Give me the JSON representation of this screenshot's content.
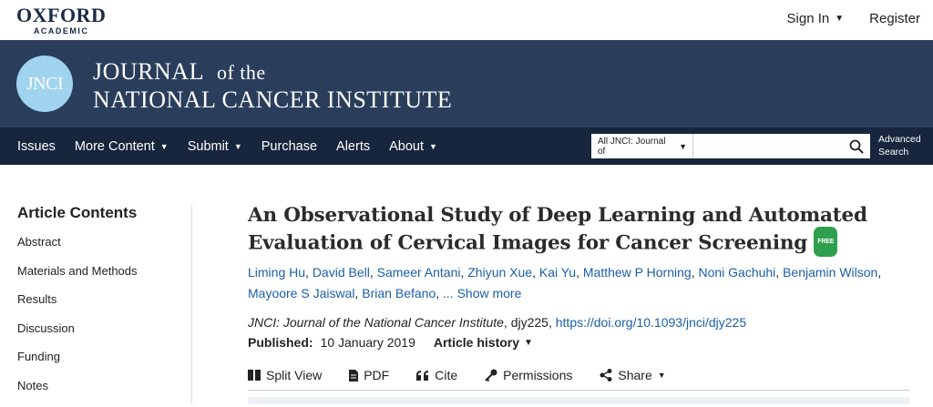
{
  "brand": {
    "word1": "OXFORD",
    "word2": "ACADEMIC"
  },
  "account": {
    "sign_in": "Sign In",
    "register": "Register"
  },
  "journal": {
    "logo": "JNCI",
    "line1a": "JOURNAL",
    "line1b": "of the",
    "line2": "NATIONAL CANCER INSTITUTE"
  },
  "nav": {
    "items": [
      {
        "label": "Issues",
        "dropdown": false
      },
      {
        "label": "More Content",
        "dropdown": true
      },
      {
        "label": "Submit",
        "dropdown": true
      },
      {
        "label": "Purchase",
        "dropdown": false
      },
      {
        "label": "Alerts",
        "dropdown": false
      },
      {
        "label": "About",
        "dropdown": true
      }
    ],
    "search_scope": "All JNCI: Journal of",
    "search_value": "",
    "advanced_line1": "Advanced",
    "advanced_line2": "Search"
  },
  "sidebar": {
    "heading": "Article Contents",
    "items": [
      "Abstract",
      "Materials and Methods",
      "Results",
      "Discussion",
      "Funding",
      "Notes"
    ]
  },
  "article": {
    "title": "An Observational Study of Deep Learning and Automated Evaluation of Cervical Images for Cancer Screening",
    "free_badge": "FREE",
    "authors": [
      "Liming Hu",
      "David Bell",
      "Sameer Antani",
      "Zhiyun Xue",
      "Kai Yu",
      "Matthew P Horning",
      "Noni Gachuhi",
      "Benjamin Wilson",
      "Mayoore S Jaiswal",
      "Brian Befano"
    ],
    "show_more": "... Show more",
    "journal_name": "JNCI: Journal of the National Cancer Institute",
    "article_id": ", djy225, ",
    "doi": "https://doi.org/10.1093/jnci/djy225",
    "published_label": "Published:",
    "published_date": "10 January 2019",
    "history_label": "Article history"
  },
  "toolbar": {
    "split_view": "Split View",
    "pdf": "PDF",
    "cite": "Cite",
    "permissions": "Permissions",
    "share": "Share"
  },
  "colors": {
    "banner": "#2a3e5c",
    "nav": "#17253d",
    "link": "#1a5fa8",
    "logo": "#9fd3ee",
    "free": "#2e9f4e"
  }
}
